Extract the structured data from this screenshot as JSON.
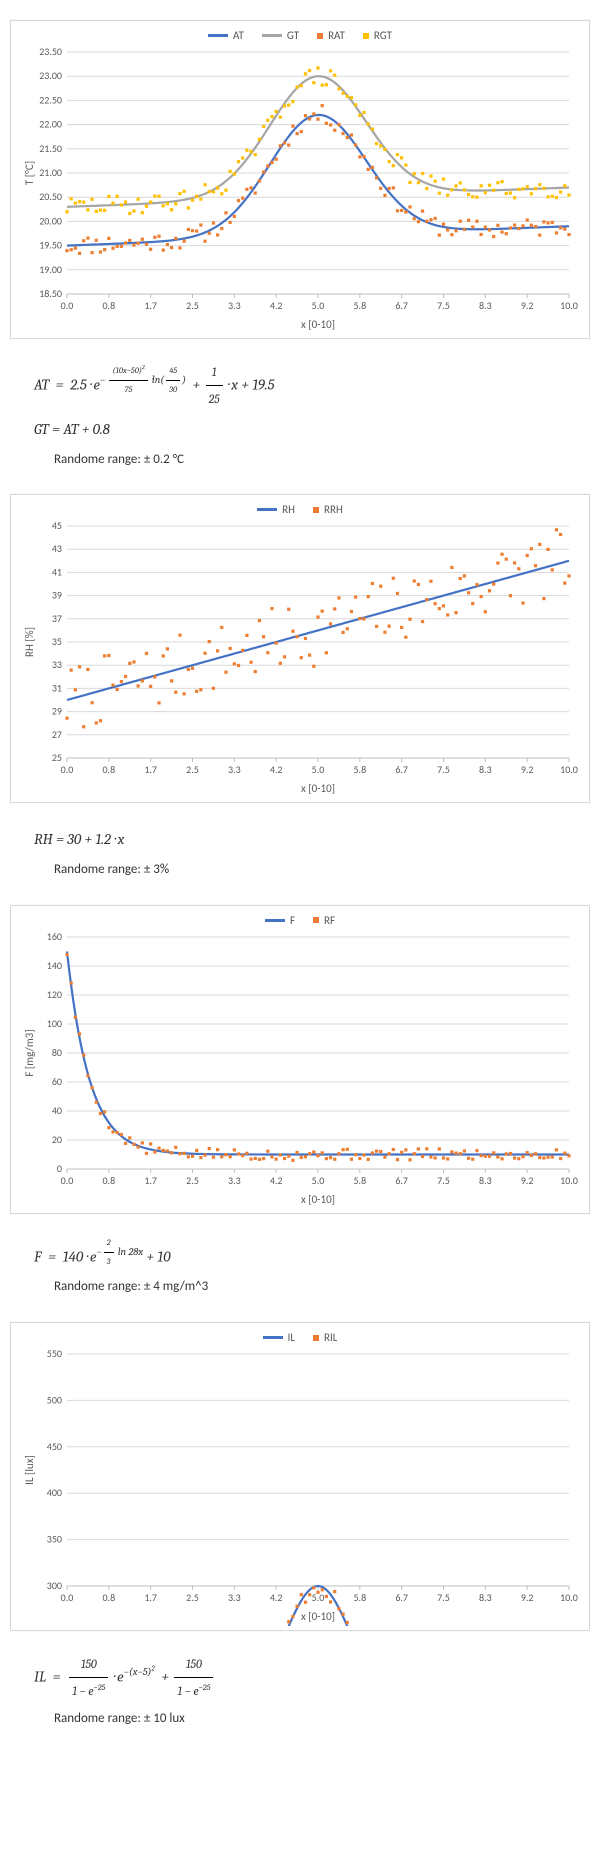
{
  "xlabel": "x [0-10]",
  "xticks": [
    "0.0",
    "0.8",
    "1.7",
    "2.5",
    "3.3",
    "4.2",
    "5.0",
    "5.8",
    "6.7",
    "7.5",
    "8.3",
    "9.2",
    "10.0"
  ],
  "colors": {
    "blue": "#4472C4",
    "lightblue": "#A5A5A5",
    "orange": "#ED7D31",
    "yellow": "#FFC000"
  },
  "chart_data": [
    {
      "id": "T",
      "type": "line+scatter",
      "ylabel": "T [°C]",
      "ylim": [
        18.5,
        23.5
      ],
      "ystep": 0.5,
      "series": [
        {
          "name": "AT",
          "kind": "line",
          "color": "blue"
        },
        {
          "name": "GT",
          "kind": "line",
          "color": "lightblue"
        },
        {
          "name": "RAT",
          "kind": "scatter",
          "color": "orange"
        },
        {
          "name": "RGT",
          "kind": "scatter",
          "color": "yellow"
        }
      ],
      "formula_AT": "AT = 2.5 · e^(-((10x-50)^2)/75 · ln(45/30)) + (1/25)·x + 19.5",
      "formula_GT": "GT = AT + 0.8",
      "random_range": "± 0.2 °C"
    },
    {
      "id": "RH",
      "type": "line+scatter",
      "ylabel": "RH [%]",
      "ylim": [
        25,
        45
      ],
      "ystep": 2,
      "series": [
        {
          "name": "RH",
          "kind": "line",
          "color": "blue"
        },
        {
          "name": "RRH",
          "kind": "scatter",
          "color": "orange"
        }
      ],
      "formula": "RH = 30 + 1.2 · x",
      "random_range": "± 3%"
    },
    {
      "id": "F",
      "type": "line+scatter",
      "ylabel": "F [mg/m3]",
      "ylim": [
        0,
        160
      ],
      "ystep": 20,
      "series": [
        {
          "name": "F",
          "kind": "line",
          "color": "blue"
        },
        {
          "name": "RF",
          "kind": "scatter",
          "color": "orange"
        }
      ],
      "formula": "F = 140 · e^(-(2/3)·ln28 · x) + 10",
      "random_range": "± 4 mg/m^3"
    },
    {
      "id": "IL",
      "type": "line+scatter",
      "ylabel": "IL [lux]",
      "ylim": [
        300,
        550
      ],
      "ystep": 50,
      "series": [
        {
          "name": "IL",
          "kind": "line",
          "color": "blue"
        },
        {
          "name": "RIL",
          "kind": "scatter",
          "color": "orange"
        }
      ],
      "formula": "IL = 150/(1 - e^-25) · e^(-(x-5)^2) + 150/(1 - e^-25)",
      "random_range": "± 10 lux"
    }
  ],
  "eq": {
    "T_at": "",
    "T_gt": "GT  =  AT + 0.8",
    "T_range": "Randome range: ± 0.2 °C",
    "RH": "RH  =  30 + 1.2 · x",
    "RH_range": "Randome range: ± 3%",
    "F": "",
    "F_range": "Randome range: ± 4 mg/m^3",
    "IL": "",
    "IL_range": "Randome range: ± 10 lux"
  }
}
